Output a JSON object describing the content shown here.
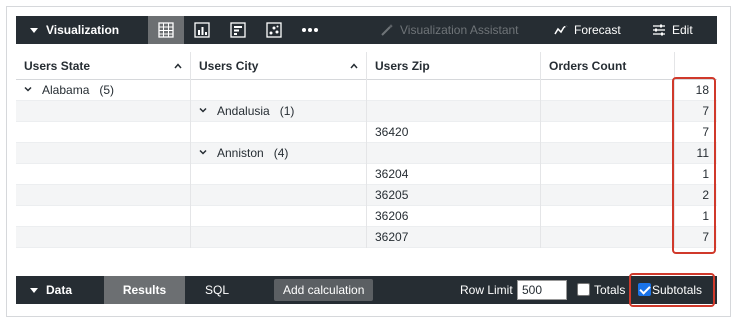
{
  "visualization": {
    "title": "Visualization",
    "assistant_label": "Visualization Assistant",
    "forecast_label": "Forecast",
    "edit_label": "Edit",
    "icons": [
      "table-icon",
      "bar-chart-icon",
      "single-value-icon",
      "scatter-icon",
      "more-icon"
    ]
  },
  "table": {
    "columns": [
      "Users State",
      "Users City",
      "Users Zip",
      "Orders Count"
    ],
    "rows": [
      {
        "state": "Alabama",
        "state_count": "(5)",
        "city": "",
        "city_count": "",
        "zip": "",
        "count": "18"
      },
      {
        "state": "",
        "state_count": "",
        "city": "Andalusia",
        "city_count": "(1)",
        "zip": "",
        "count": "7"
      },
      {
        "state": "",
        "state_count": "",
        "city": "",
        "city_count": "",
        "zip": "36420",
        "count": "7"
      },
      {
        "state": "",
        "state_count": "",
        "city": "Anniston",
        "city_count": "(4)",
        "zip": "",
        "count": "11"
      },
      {
        "state": "",
        "state_count": "",
        "city": "",
        "city_count": "",
        "zip": "36204",
        "count": "1"
      },
      {
        "state": "",
        "state_count": "",
        "city": "",
        "city_count": "",
        "zip": "36205",
        "count": "2"
      },
      {
        "state": "",
        "state_count": "",
        "city": "",
        "city_count": "",
        "zip": "36206",
        "count": "1"
      },
      {
        "state": "",
        "state_count": "",
        "city": "",
        "city_count": "",
        "zip": "36207",
        "count": "7"
      }
    ]
  },
  "data_bar": {
    "title": "Data",
    "results_tab": "Results",
    "sql_tab": "SQL",
    "add_calculation": "Add calculation",
    "row_limit_label": "Row Limit",
    "row_limit_value": "500",
    "totals_label": "Totals",
    "totals_checked": false,
    "subtotals_label": "Subtotals",
    "subtotals_checked": true
  },
  "colors": {
    "toolbar_bg": "#262d33",
    "highlight": "#d0392b",
    "checkbox_accent": "#1a73e8"
  }
}
